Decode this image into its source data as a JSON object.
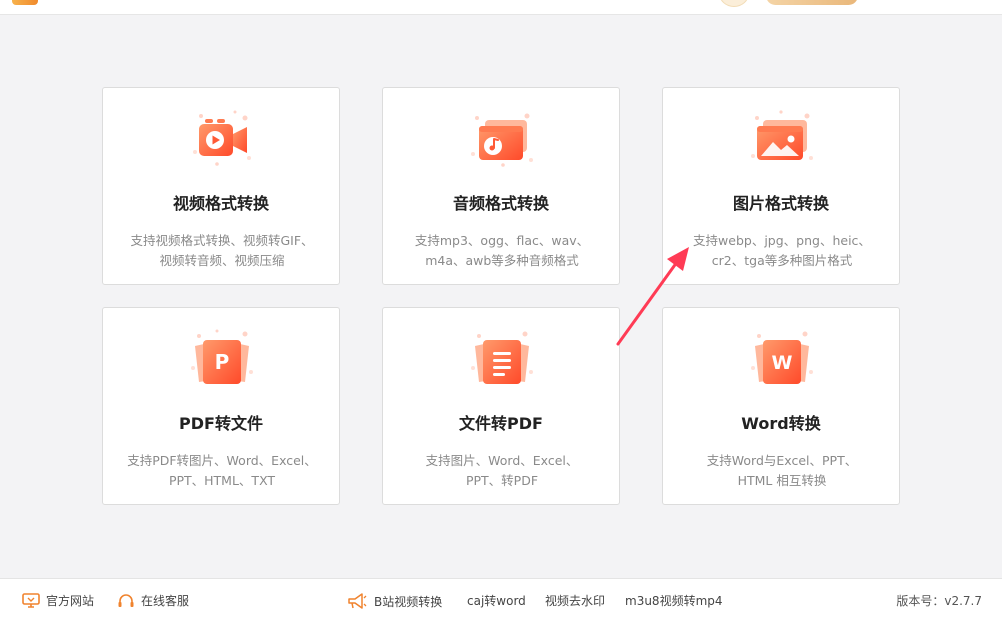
{
  "cards": [
    {
      "title": "视频格式转换",
      "desc_line1": "支持视频格式转换、视频转GIF、",
      "desc_line2": "视频转音频、视频压缩",
      "icon": "video-camera-icon"
    },
    {
      "title": "音频格式转换",
      "desc_line1": "支持mp3、ogg、flac、wav、",
      "desc_line2": "m4a、awb等多种音频格式",
      "icon": "music-note-icon"
    },
    {
      "title": "图片格式转换",
      "desc_line1": "支持webp、jpg、png、heic、",
      "desc_line2": "cr2、tga等多种图片格式",
      "icon": "image-icon"
    },
    {
      "title": "PDF转文件",
      "desc_line1": "支持PDF转图片、Word、Excel、",
      "desc_line2": "PPT、HTML、TXT",
      "icon": "pdf-p-icon",
      "glyph": "P"
    },
    {
      "title": "文件转PDF",
      "desc_line1": "支持图片、Word、Excel、",
      "desc_line2": "PPT、转PDF",
      "icon": "document-lines-icon"
    },
    {
      "title": "Word转换",
      "desc_line1": "支持Word与Excel、PPT、",
      "desc_line2": "HTML 相互转换",
      "icon": "word-w-icon",
      "glyph": "W"
    }
  ],
  "footer": {
    "official_site": "官方网站",
    "online_service": "在线客服",
    "links": [
      "B站视频转换",
      "caj转word",
      "视频去水印",
      "m3u8视频转mp4"
    ],
    "version": "版本号：v2.7.7"
  },
  "colors": {
    "accent_start": "#ff8a5c",
    "accent_end": "#ff4f2e",
    "annotation_arrow": "#ff3b55"
  },
  "icons": {
    "monitor": "monitor-icon",
    "headset": "headset-icon",
    "megaphone": "megaphone-icon"
  }
}
